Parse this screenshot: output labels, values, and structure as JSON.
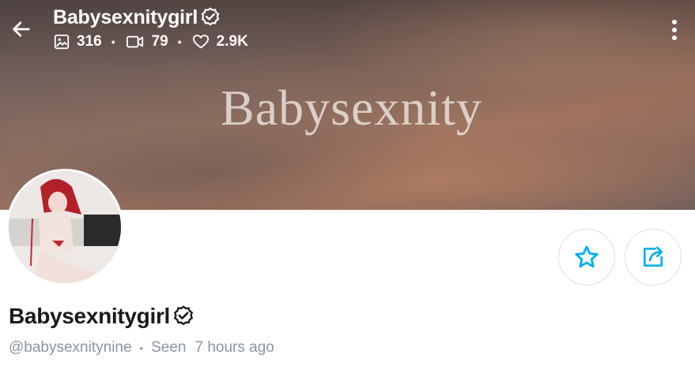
{
  "header": {
    "name": "Babysexnitygirl",
    "stats": {
      "photos": "316",
      "videos": "79",
      "likes": "2.9K"
    }
  },
  "cover": {
    "watermark": "Babysexnity"
  },
  "profile": {
    "name": "Babysexnitygirl",
    "handle": "@babysexnitynine",
    "seen_label": "Seen",
    "seen_time": "7 hours ago"
  },
  "separator": "•",
  "icons": {
    "back": "arrow-left-icon",
    "verified": "verified-badge-icon",
    "photos": "image-icon",
    "videos": "video-camera-icon",
    "likes": "heart-icon",
    "more": "more-vertical-icon",
    "favorite": "star-icon",
    "share": "share-icon"
  },
  "colors": {
    "accent": "#00aff0",
    "muted": "#8a96a3",
    "text": "#1a1a1a"
  }
}
